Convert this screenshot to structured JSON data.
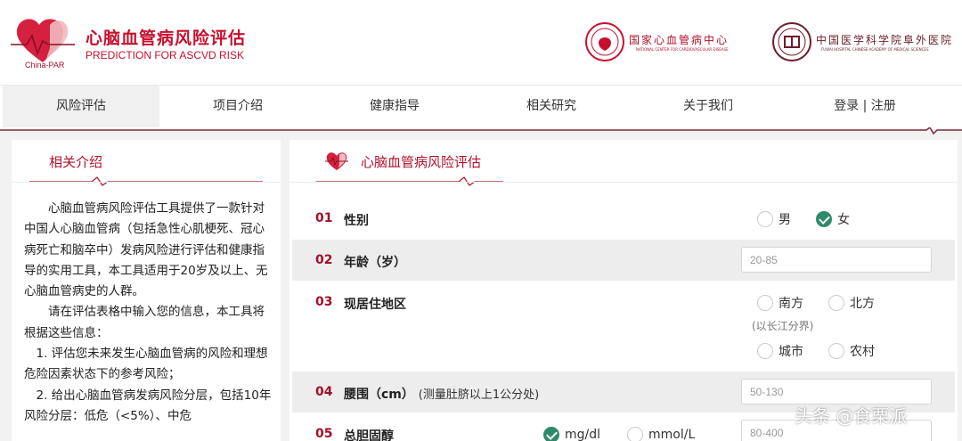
{
  "brand": {
    "title": "心脑血管病风险评估",
    "subtitle": "PREDICTION FOR ASCVD RISK",
    "logo_text": "China-PAR"
  },
  "partners": [
    {
      "name": "国家心血管病中心",
      "en": "NATIONAL CENTER FOR CARDIOVASCULAR DISEASE"
    },
    {
      "name": "中国医学科学院阜外医院",
      "en": "FUWAI HOSPITAL   CHINESE ACADEMY OF MEDICAL SCIENCES"
    }
  ],
  "nav": {
    "items": [
      {
        "label": "风险评估",
        "active": true
      },
      {
        "label": "项目介绍",
        "active": false
      },
      {
        "label": "健康指导",
        "active": false
      },
      {
        "label": "相关研究",
        "active": false
      },
      {
        "label": "关于我们",
        "active": false
      },
      {
        "label": "登录 | 注册",
        "active": false
      }
    ]
  },
  "intro": {
    "title": "相关介绍",
    "p1": "心脑血管病风险评估工具提供了一款针对中国人心脑血管病（包括急性心肌梗死、冠心病死亡和脑卒中）发病风险进行评估和健康指导的实用工具，本工具适用于20岁及以上、无心脑血管病史的人群。",
    "p2": "请在评估表格中输入您的信息，本工具将根据这些信息：",
    "p3": "1. 评估您未来发生心脑血管病的风险和理想危险因素状态下的参考风险；",
    "p4": "2. 给出心脑血管病发病风险分层，包括10年风险分层：低危（<5%）、中危"
  },
  "form": {
    "title": "心脑血管病风险评估",
    "q1": {
      "num": "01",
      "label": "性别",
      "opt_male": "男",
      "opt_female": "女",
      "selected": "女"
    },
    "q2": {
      "num": "02",
      "label": "年龄（岁）",
      "placeholder": "20-85"
    },
    "q3": {
      "num": "03",
      "label": "现居住地区",
      "opt_south": "南方",
      "opt_north": "北方",
      "hint": "(以长江分界)",
      "opt_city": "城市",
      "opt_rural": "农村"
    },
    "q4": {
      "num": "04",
      "label": "腰围（cm）",
      "note": "(测量肚脐以上1公分处)",
      "placeholder": "50-130"
    },
    "q5": {
      "num": "05",
      "label": "总胆固醇",
      "unit1": "mg/dl",
      "unit2": "mmol/L",
      "selected_unit": "mg/dl",
      "placeholder": "80-400"
    }
  },
  "colors": {
    "brand": "#c8102e",
    "accent_green": "#2f8a6b",
    "row_shade": "#ededed"
  },
  "watermark": "头条 @食栗派"
}
